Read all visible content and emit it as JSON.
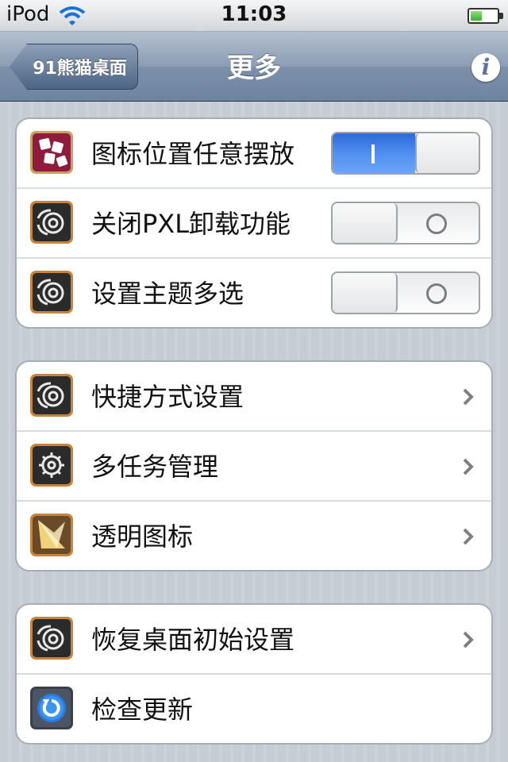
{
  "status_bar": {
    "carrier": "iPod",
    "time": "11:03",
    "battery_level": 0.45
  },
  "nav_bar": {
    "back_label": "91熊猫桌面",
    "title": "更多",
    "info_label": "i"
  },
  "groups": [
    {
      "rows": [
        {
          "label": "图标位置任意摆放",
          "icon": "dice-app-icon",
          "control": "switch",
          "on": true
        },
        {
          "label": "关闭PXL卸载功能",
          "icon": "gear-swirl-icon",
          "control": "switch",
          "on": false
        },
        {
          "label": "设置主题多选",
          "icon": "gear-swirl-icon",
          "control": "switch",
          "on": false
        }
      ]
    },
    {
      "rows": [
        {
          "label": "快捷方式设置",
          "icon": "gear-swirl-icon",
          "control": "chevron"
        },
        {
          "label": "多任务管理",
          "icon": "gear-icon",
          "control": "chevron"
        },
        {
          "label": "透明图标",
          "icon": "transparent-icon",
          "control": "chevron"
        }
      ]
    },
    {
      "rows": [
        {
          "label": "恢复桌面初始设置",
          "icon": "gear-swirl-icon",
          "control": "chevron"
        },
        {
          "label": "检查更新",
          "icon": "refresh-icon",
          "control": "none"
        }
      ]
    }
  ],
  "colors": {
    "switch_on": "#3e7fe6",
    "nav_bar": "#7d90a9",
    "background": "#c5ccd4"
  }
}
